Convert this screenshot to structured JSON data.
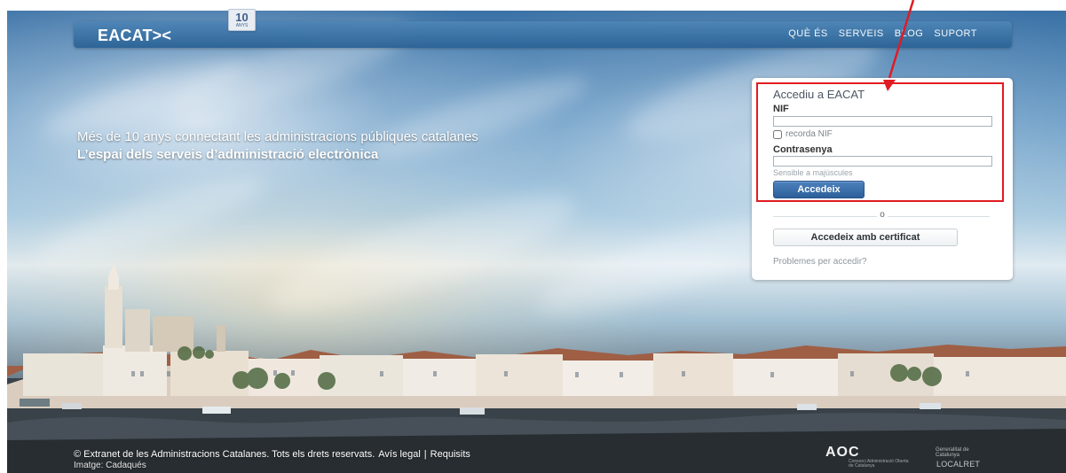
{
  "header": {
    "logo": "EACAT><",
    "anniversary": {
      "number": "10",
      "subtext": "ANYS"
    },
    "nav": [
      {
        "label": "QUÈ ÉS"
      },
      {
        "label": "SERVEIS"
      },
      {
        "label": "BLOG"
      },
      {
        "label": "SUPORT"
      }
    ]
  },
  "hero": {
    "line1": "Més de 10 anys connectant les administracions públiques catalanes",
    "line2": "L’espai dels serveis d’administració electrònica"
  },
  "login": {
    "title": "Accediu a EACAT",
    "nif_label": "NIF",
    "nif_value": "",
    "remember_label": "recorda NIF",
    "password_label": "Contrasenya",
    "password_value": "",
    "hint": "Sensible a majúscules",
    "submit_label": "Accedeix",
    "divider": "o",
    "certificate_label": "Accedeix amb certificat",
    "help_link": "Problemes per accedir?"
  },
  "footer": {
    "copyright": "© Extranet de les Administracions Catalanes. Tots els drets reservats.",
    "legal_link": "Avís legal",
    "separator": "|",
    "requirements_link": "Requisits",
    "image_label": "Imatge:",
    "image_name": "Cadaqués"
  },
  "partners": {
    "aoc": "AOC",
    "aoc_subtitle": "Consorci Administració Oberta de Catalunya",
    "generalitat_top": "Generalitat de Catalunya",
    "localret": "LOCALRET"
  },
  "annotation": {
    "color": "#e11b22"
  }
}
